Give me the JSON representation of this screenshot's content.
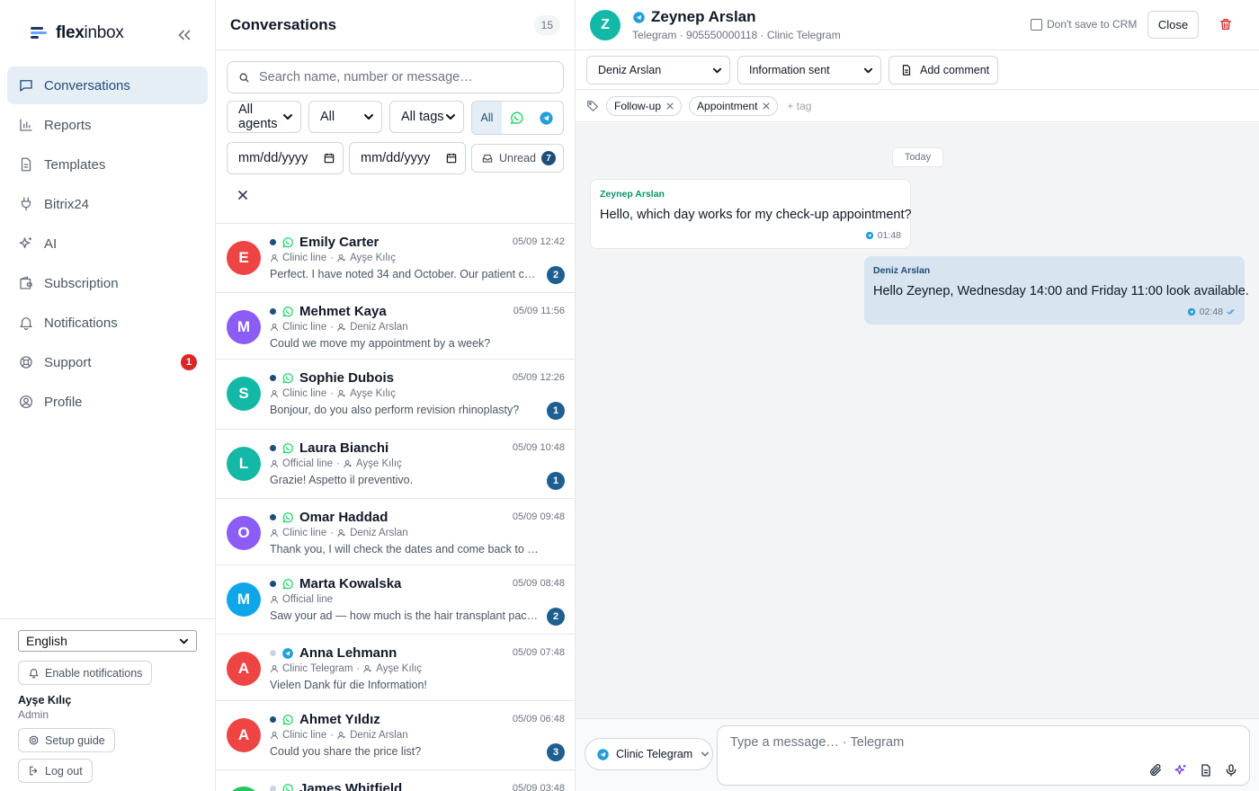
{
  "brand": {
    "name_bold": "flex",
    "name_rest": "inbox"
  },
  "sidebar": {
    "items": [
      {
        "label": "Conversations",
        "icon": "chat-icon"
      },
      {
        "label": "Reports",
        "icon": "bar-chart-icon"
      },
      {
        "label": "Templates",
        "icon": "document-icon"
      },
      {
        "label": "Bitrix24",
        "icon": "plug-icon"
      },
      {
        "label": "AI",
        "icon": "sparkle-icon"
      },
      {
        "label": "Subscription",
        "icon": "wallet-icon"
      },
      {
        "label": "Notifications",
        "icon": "bell-icon"
      },
      {
        "label": "Support",
        "icon": "lifebuoy-icon",
        "badge": "1"
      },
      {
        "label": "Profile",
        "icon": "user-circle-icon"
      }
    ],
    "language": "English",
    "enable_notifications": "Enable notifications",
    "user_name": "Ayşe Kılıç",
    "user_role": "Admin",
    "setup_guide": "Setup guide",
    "logout": "Log out"
  },
  "conversations": {
    "title": "Conversations",
    "count": "15",
    "search_placeholder": "Search name, number or message…",
    "filter_agents": "All agents",
    "filter_status": "All",
    "filter_tags": "All tags",
    "channel_all": "All",
    "date_from": "mm/dd/yyyy",
    "date_to": "mm/dd/yyyy",
    "unread_label": "Unread",
    "unread_count": "7",
    "items": [
      {
        "initial": "E",
        "color": "#ef4444",
        "name": "Emily Carter",
        "channel": "whatsapp",
        "unread": true,
        "time": "05/09 12:42",
        "line": "Clinic line",
        "agent": "Ayşe Kılıç",
        "preview": "Perfect. I have noted 34 and October. Our patient con…",
        "badge": "2"
      },
      {
        "initial": "M",
        "color": "#8b5cf6",
        "name": "Mehmet Kaya",
        "channel": "whatsapp",
        "unread": true,
        "time": "05/09 11:56",
        "line": "Clinic line",
        "agent": "Deniz Arslan",
        "preview": "Could we move my appointment by a week?",
        "badge": ""
      },
      {
        "initial": "S",
        "color": "#14b8a6",
        "name": "Sophie Dubois",
        "channel": "whatsapp",
        "unread": true,
        "time": "05/09 12:26",
        "line": "Clinic line",
        "agent": "Ayşe Kılıç",
        "preview": "Bonjour, do you also perform revision rhinoplasty?",
        "badge": "1"
      },
      {
        "initial": "L",
        "color": "#14b8a6",
        "name": "Laura Bianchi",
        "channel": "whatsapp",
        "unread": true,
        "time": "05/09 10:48",
        "line": "Official line",
        "agent": "Ayşe Kılıç",
        "preview": "Grazie! Aspetto il preventivo.",
        "badge": "1"
      },
      {
        "initial": "O",
        "color": "#8b5cf6",
        "name": "Omar Haddad",
        "channel": "whatsapp",
        "unread": true,
        "time": "05/09 09:48",
        "line": "Clinic line",
        "agent": "Deniz Arslan",
        "preview": "Thank you, I will check the dates and come back to you.",
        "badge": ""
      },
      {
        "initial": "M",
        "color": "#0ea5e9",
        "name": "Marta Kowalska",
        "channel": "whatsapp",
        "unread": true,
        "time": "05/09 08:48",
        "line": "Official line",
        "agent": "",
        "preview": "Saw your ad — how much is the hair transplant packa…",
        "badge": "2"
      },
      {
        "initial": "A",
        "color": "#ef4444",
        "name": "Anna Lehmann",
        "channel": "telegram",
        "unread": false,
        "time": "05/09 07:48",
        "line": "Clinic Telegram",
        "agent": "Ayşe Kılıç",
        "preview": "Vielen Dank für die Information!",
        "badge": ""
      },
      {
        "initial": "A",
        "color": "#ef4444",
        "name": "Ahmet Yıldız",
        "channel": "whatsapp",
        "unread": true,
        "time": "05/09 06:48",
        "line": "Clinic line",
        "agent": "Deniz Arslan",
        "preview": "Could you share the price list?",
        "badge": "3"
      },
      {
        "initial": "J",
        "color": "#22c55e",
        "name": "James Whitfield",
        "channel": "whatsapp",
        "unread": false,
        "time": "05/09 03:48",
        "line": "",
        "agent": "",
        "preview": "",
        "badge": ""
      }
    ]
  },
  "chat": {
    "initial": "Z",
    "name": "Zeynep Arslan",
    "subtitle": "Telegram · 905550000118 · Clinic Telegram",
    "dont_save_crm": "Don't save to CRM",
    "close": "Close",
    "assignee": "Deniz Arslan",
    "status": "Information sent",
    "add_comment": "Add comment",
    "tags": [
      "Follow-up",
      "Appointment"
    ],
    "add_tag": "+ tag",
    "day_label": "Today",
    "messages": [
      {
        "direction": "in",
        "sender": "Zeynep Arslan",
        "text": "Hello, which day works for my check-up appointment?",
        "time": "01:48"
      },
      {
        "direction": "out",
        "sender": "Deniz Arslan",
        "text": "Hello Zeynep, Wednesday 14:00 and Friday 11:00 look available.",
        "time": "02:48"
      }
    ],
    "send_channel": "Clinic Telegram",
    "composer_placeholder": "Type a message… · Telegram"
  },
  "colors": {
    "accent": "#1e4d7b",
    "whatsapp": "#25d366",
    "telegram": "#229ed9",
    "danger": "#dc2626"
  }
}
